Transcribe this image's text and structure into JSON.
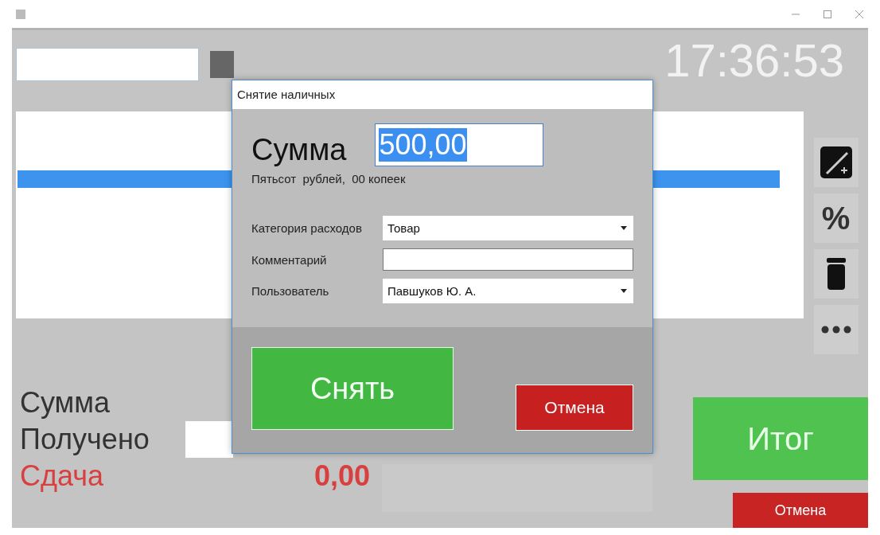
{
  "main": {
    "clock": "17:36:53",
    "table": {
      "rows": [
        {
          "selected": false
        },
        {
          "selected": false
        },
        {
          "selected": true
        }
      ]
    },
    "side_buttons": [
      {
        "kind": "edit"
      },
      {
        "kind": "percent",
        "label": "%"
      },
      {
        "kind": "trash"
      },
      {
        "kind": "more"
      }
    ],
    "totals": {
      "sum_label": "Сумма",
      "received_label": "Получено",
      "change_label": "Сдача",
      "change_value": "0,00"
    },
    "total_button": "Итог",
    "cancel_button": "Отмена"
  },
  "dialog": {
    "title": "Снятие наличных",
    "amount_label": "Сумма",
    "amount": {
      "value": "500,00",
      "text_selected": true
    },
    "amount_words": "Пятьсот  рублей,  00 копеек",
    "fields": [
      {
        "kind": "dropdown",
        "label": "Категория расходов",
        "value": "Товар"
      },
      {
        "kind": "text",
        "label": "Комментарий"
      },
      {
        "kind": "dropdown",
        "label": "Пользователь",
        "value": "Павшуков Ю. А."
      }
    ],
    "withdraw_button": "Снять",
    "cancel_button": "Отмена"
  }
}
